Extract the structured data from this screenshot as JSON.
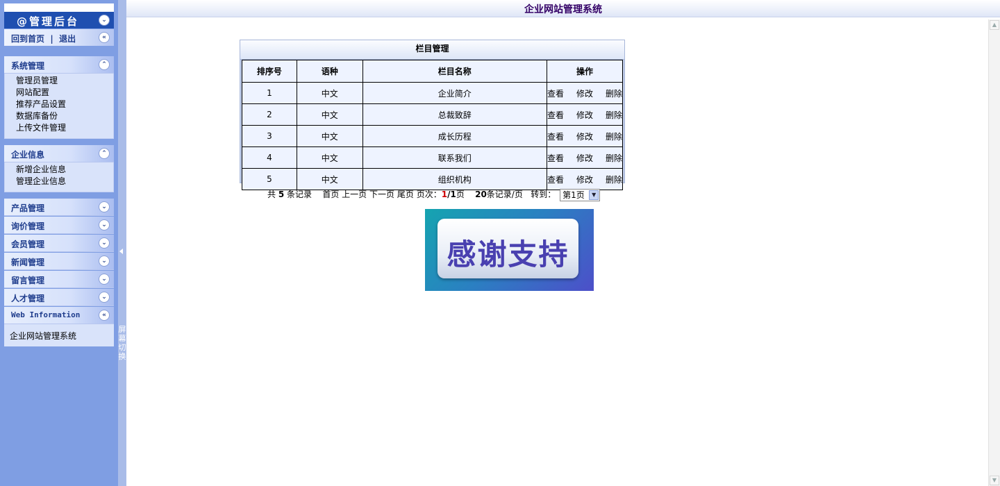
{
  "sidebar": {
    "admin_title": "@管理后台",
    "home_link": "回到首页",
    "separator": "|",
    "logout_link": "退出",
    "sections": {
      "system": {
        "title": "系统管理",
        "items": [
          "管理员管理",
          "网站配置",
          "推荐产品设置",
          "数据库备份",
          "上传文件管理"
        ]
      },
      "company": {
        "title": "企业信息",
        "items": [
          "新增企业信息",
          "管理企业信息"
        ]
      },
      "product": {
        "title": "产品管理"
      },
      "inquiry": {
        "title": "询价管理"
      },
      "member": {
        "title": "会员管理"
      },
      "news": {
        "title": "新闻管理"
      },
      "message": {
        "title": "留言管理"
      },
      "talent": {
        "title": "人才管理"
      },
      "web_info": {
        "title": "Web Information",
        "text": "企业网站管理系统"
      }
    },
    "toggle_glyph_expand": "⌃",
    "toggle_glyph_collapse": "⌄",
    "toggle_glyph_left": "«",
    "splitter_label": "屏幕切换"
  },
  "topbar": {
    "title": "企业网站管理系统"
  },
  "table": {
    "title": "栏目管理",
    "headers": [
      "排序号",
      "语种",
      "栏目名称",
      "操作"
    ],
    "rows": [
      {
        "no": "1",
        "lang": "中文",
        "name": "企业简介"
      },
      {
        "no": "2",
        "lang": "中文",
        "name": "总裁致辞"
      },
      {
        "no": "3",
        "lang": "中文",
        "name": "成长历程"
      },
      {
        "no": "4",
        "lang": "中文",
        "name": "联系我们"
      },
      {
        "no": "5",
        "lang": "中文",
        "name": "组织机构"
      }
    ],
    "ops": {
      "view": "查看",
      "edit": "修改",
      "delete": "删除"
    }
  },
  "pager": {
    "total_prefix": "共",
    "total": "5",
    "total_suffix": "条记录",
    "first": "首页",
    "prev": "上一页",
    "next": "下一页",
    "last": "尾页",
    "page_label": "页次：",
    "current": "1",
    "slash": "/",
    "pages": "1",
    "page_unit": "页",
    "per_page": "20",
    "per_page_suffix": "条记录/页",
    "goto_label": "转到：",
    "goto_value": "第1页"
  },
  "banner": {
    "text": "感谢支持"
  },
  "colors": {
    "sidebar_bg": "#7f9ee3",
    "admin_bar": "#1f4fb0",
    "title_purple": "#330066",
    "current_page": "#cc0000"
  }
}
